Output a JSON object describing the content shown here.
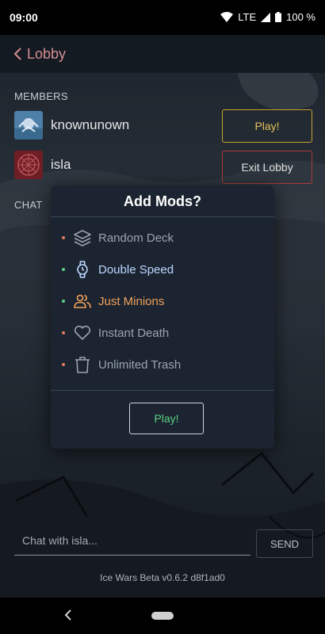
{
  "status_bar": {
    "time": "09:00",
    "network": "LTE",
    "battery": "100 %"
  },
  "app_bar": {
    "back_label": "Lobby"
  },
  "members_section": {
    "label": "MEMBERS",
    "members": [
      {
        "name": "knownunown"
      },
      {
        "name": "isla"
      }
    ]
  },
  "chat_section": {
    "label": "CHAT"
  },
  "actions": {
    "play_label": "Play!",
    "exit_label": "Exit Lobby"
  },
  "modal": {
    "title": "Add Mods?",
    "mods": [
      {
        "label": "Random Deck",
        "icon": "layers-icon",
        "selected": false,
        "label_color": "#9aa3ad",
        "dot_color": "#e07a5f"
      },
      {
        "label": "Double Speed",
        "icon": "watch-icon",
        "selected": true,
        "label_color": "#bcd6ff",
        "dot_color": "#5ecf86"
      },
      {
        "label": "Just Minions",
        "icon": "users-icon",
        "selected": true,
        "label_color": "#f2a15c",
        "dot_color": "#5ecf86"
      },
      {
        "label": "Instant Death",
        "icon": "heart-icon",
        "selected": false,
        "label_color": "#9aa3ad",
        "dot_color": "#e07a5f"
      },
      {
        "label": "Unlimited Trash",
        "icon": "trash-icon",
        "selected": false,
        "label_color": "#9aa3ad",
        "dot_color": "#e07a5f"
      }
    ],
    "play_label": "Play!"
  },
  "chat_input": {
    "placeholder": "Chat with isla...",
    "value": "",
    "send_label": "SEND"
  },
  "footer": {
    "version": "Ice Wars Beta v0.6.2 d8f1ad0"
  },
  "colors": {
    "accent_gold": "#c9a233",
    "accent_red": "#b03a3a",
    "back_link": "#d58d93",
    "modal_bg": "#1b2430"
  }
}
